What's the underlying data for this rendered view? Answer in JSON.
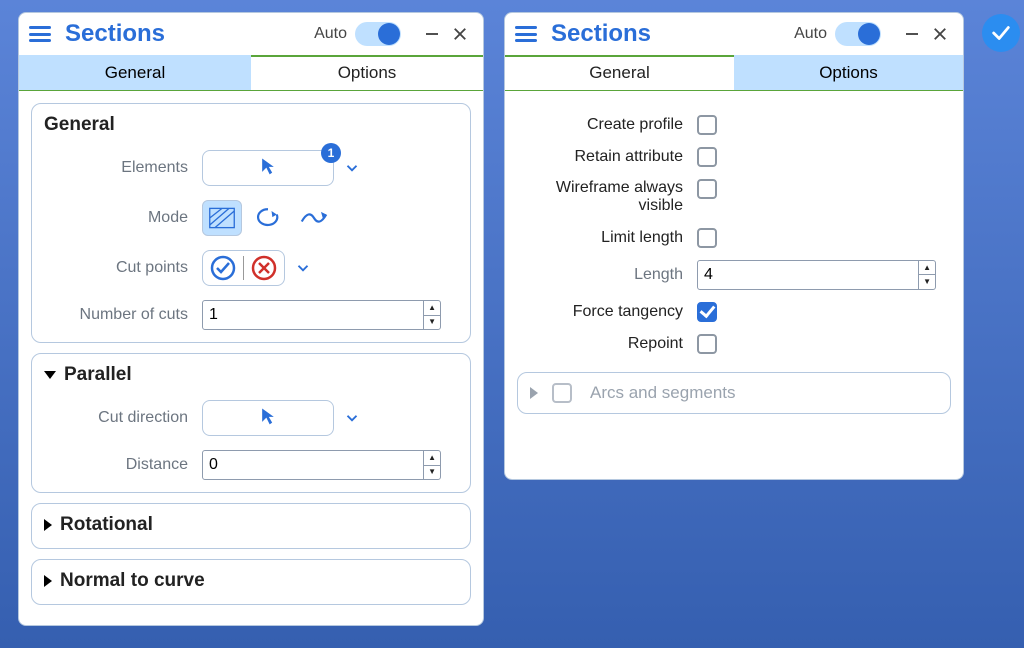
{
  "colors": {
    "accent": "#2a6ed8",
    "accent_light": "#bfe0ff",
    "tab_underline": "#5aa53a"
  },
  "left_panel": {
    "title": "Sections",
    "auto_label": "Auto",
    "auto_on": true,
    "tabs": {
      "general": "General",
      "options": "Options",
      "active": "general"
    },
    "groups": {
      "general": {
        "title": "General",
        "rows": {
          "elements": {
            "label": "Elements",
            "badge": "1"
          },
          "mode": {
            "label": "Mode",
            "active_index": 0,
            "names": [
              "hatch-plane",
              "rotate",
              "wave"
            ]
          },
          "cutpoints": {
            "label": "Cut points"
          },
          "numcuts": {
            "label": "Number of cuts",
            "value": "1"
          }
        }
      },
      "parallel": {
        "title": "Parallel",
        "expanded": true,
        "rows": {
          "cutdir": {
            "label": "Cut direction"
          },
          "distance": {
            "label": "Distance",
            "value": "0"
          }
        }
      },
      "rotational": {
        "title": "Rotational",
        "expanded": false
      },
      "normal": {
        "title": "Normal to curve",
        "expanded": false
      }
    }
  },
  "right_panel": {
    "title": "Sections",
    "auto_label": "Auto",
    "auto_on": true,
    "tabs": {
      "general": "General",
      "options": "Options",
      "active": "options"
    },
    "options": {
      "create_profile": {
        "label": "Create profile",
        "checked": false
      },
      "retain_attribute": {
        "label": "Retain attribute",
        "checked": false
      },
      "wireframe": {
        "label": "Wireframe always visible",
        "checked": false
      },
      "limit_length": {
        "label": "Limit length",
        "checked": false
      },
      "length": {
        "label": "Length",
        "value": "4"
      },
      "force_tangency": {
        "label": "Force tangency",
        "checked": true
      },
      "repoint": {
        "label": "Repoint",
        "checked": false
      },
      "arcs_segments": {
        "label": "Arcs and segments",
        "expanded": false,
        "checked": false
      }
    }
  }
}
